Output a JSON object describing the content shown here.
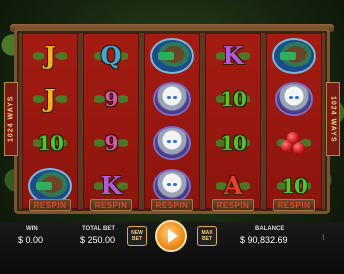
{
  "side_banners": {
    "left": "1024 WAYS",
    "right": "1024 WAYS"
  },
  "reels": [
    {
      "symbols": [
        {
          "type": "letter",
          "text": "J",
          "color": "#f2b31e"
        },
        {
          "type": "letter",
          "text": "J",
          "color": "#f2b31e"
        },
        {
          "type": "number",
          "text": "10",
          "color": "#4ec52a"
        },
        {
          "type": "wild",
          "icon": "deer-wild-icon"
        }
      ],
      "respin": "RESPIN"
    },
    {
      "symbols": [
        {
          "type": "letter",
          "text": "Q",
          "color": "#3aa8e0"
        },
        {
          "type": "number",
          "text": "9",
          "color": "#e64fb0"
        },
        {
          "type": "number",
          "text": "9",
          "color": "#e64fb0"
        },
        {
          "type": "letter",
          "text": "K",
          "color": "#b05ad8"
        }
      ],
      "respin": "RESPIN"
    },
    {
      "symbols": [
        {
          "type": "wild",
          "icon": "deer-wild-icon"
        },
        {
          "type": "tiger",
          "icon": "white-tiger-icon"
        },
        {
          "type": "tiger",
          "icon": "white-tiger-icon"
        },
        {
          "type": "tiger",
          "icon": "white-tiger-icon"
        }
      ],
      "respin": "RESPIN"
    },
    {
      "symbols": [
        {
          "type": "letter",
          "text": "K",
          "color": "#b05ad8"
        },
        {
          "type": "number",
          "text": "10",
          "color": "#4ec52a"
        },
        {
          "type": "number",
          "text": "10",
          "color": "#4ec52a"
        },
        {
          "type": "letter",
          "text": "A",
          "color": "#e8402a"
        }
      ],
      "respin": "RESPIN"
    },
    {
      "symbols": [
        {
          "type": "wild",
          "icon": "deer-wild-icon"
        },
        {
          "type": "tiger",
          "icon": "white-tiger-icon"
        },
        {
          "type": "cherry",
          "icon": "cherry-icon"
        },
        {
          "type": "number",
          "text": "10",
          "color": "#4ec52a"
        }
      ],
      "respin": "RESPIN"
    }
  ],
  "bottom": {
    "win_label": "WIN",
    "win_value": "$ 0.00",
    "total_bet_label": "TOTAL BET",
    "total_bet_value": "$ 250.00",
    "new_bet_label": "NEW BET",
    "max_bet_label": "MAX BET",
    "balance_label": "BALANCE",
    "balance_value": "$ 90,832.69"
  }
}
